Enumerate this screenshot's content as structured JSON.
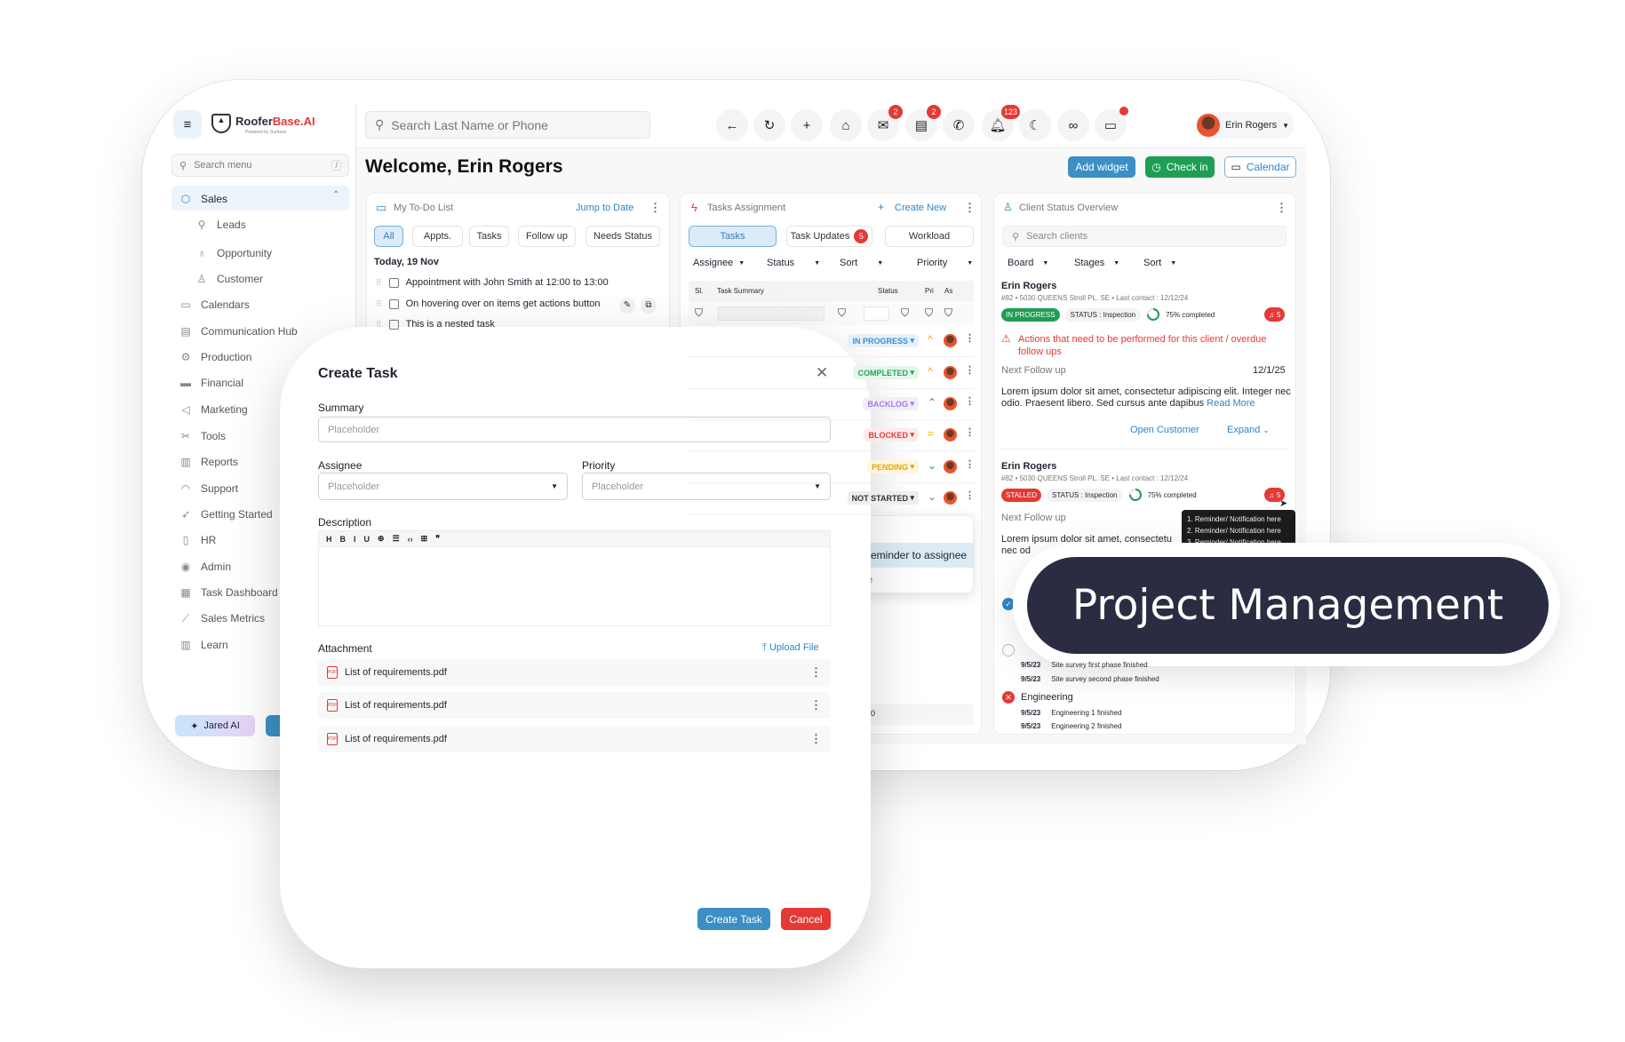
{
  "brand": {
    "name_a": "Roofer",
    "name_b": "Base.AI",
    "sub": "Powered by Surbase",
    "accent": "#e53935"
  },
  "sidebar": {
    "search_placeholder": "Search menu",
    "shortcut": "/",
    "items": [
      {
        "label": "Sales",
        "icon": "sales-icon",
        "glyph": "⬡",
        "active": true,
        "sub": false
      },
      {
        "label": "Leads",
        "icon": "leads-icon",
        "glyph": "⚲",
        "sub": true
      },
      {
        "label": "Opportunity",
        "icon": "lightbulb-icon",
        "glyph": "♁",
        "sub": true
      },
      {
        "label": "Customer",
        "icon": "customer-icon",
        "glyph": "♙",
        "sub": true
      },
      {
        "label": "Calendars",
        "icon": "calendar-icon",
        "glyph": "▭",
        "sub": false
      },
      {
        "label": "Communication Hub",
        "icon": "chat-icon",
        "glyph": "▤",
        "sub": false
      },
      {
        "label": "Production",
        "icon": "production-icon",
        "glyph": "⚙",
        "sub": false
      },
      {
        "label": "Financial",
        "icon": "wallet-icon",
        "glyph": "▬",
        "sub": false
      },
      {
        "label": "Marketing",
        "icon": "megaphone-icon",
        "glyph": "◁",
        "sub": false
      },
      {
        "label": "Tools",
        "icon": "tools-icon",
        "glyph": "✂",
        "sub": false
      },
      {
        "label": "Reports",
        "icon": "reports-icon",
        "glyph": "▥",
        "sub": false
      },
      {
        "label": "Support",
        "icon": "headset-icon",
        "glyph": "◠",
        "sub": false
      },
      {
        "label": "Getting Started",
        "icon": "rocket-icon",
        "glyph": "➶",
        "sub": false
      },
      {
        "label": "HR",
        "icon": "badge-icon",
        "glyph": "▯",
        "sub": false
      },
      {
        "label": "Admin",
        "icon": "shield-icon",
        "glyph": "◉",
        "sub": false
      },
      {
        "label": "Task Dashboard",
        "icon": "dashboard-icon",
        "glyph": "▦",
        "sub": false
      },
      {
        "label": "Sales Metrics",
        "icon": "chart-icon",
        "glyph": "⟋",
        "sub": false
      },
      {
        "label": "Learn",
        "icon": "books-icon",
        "glyph": "▥",
        "sub": false
      }
    ],
    "jared": "Jared AI"
  },
  "header": {
    "search_placeholder": "Search Last Name or Phone",
    "icons": [
      {
        "name": "back-icon",
        "glyph": "←"
      },
      {
        "name": "refresh-icon",
        "glyph": "↻"
      },
      {
        "name": "add-icon",
        "glyph": "+"
      },
      {
        "name": "home-icon",
        "glyph": "⌂"
      },
      {
        "name": "mail-icon",
        "glyph": "✉",
        "badge": "2"
      },
      {
        "name": "message-icon",
        "glyph": "▤",
        "badge": "2"
      },
      {
        "name": "phone-icon",
        "glyph": "✆"
      },
      {
        "name": "bell-icon",
        "glyph": "🔔︎",
        "badge": "123"
      },
      {
        "name": "moon-icon",
        "glyph": "☾"
      },
      {
        "name": "glasses-icon",
        "glyph": "∞"
      },
      {
        "name": "window-icon",
        "glyph": "▭",
        "dot": true
      }
    ],
    "user": "Erin Rogers"
  },
  "welcome": "Welcome, Erin Rogers",
  "actions": {
    "add_widget": "Add widget",
    "check_in": "Check in",
    "calendar": "Calendar"
  },
  "todo": {
    "title": "My To-Do List",
    "jump": "Jump to Date",
    "filters": [
      "All",
      "Appts.",
      "Tasks",
      "Follow up",
      "Needs Status"
    ],
    "date": "Today, 19 Nov",
    "items": [
      "Appointment with John Smith at 12:00 to 13:00",
      "On hovering over on items get actions button",
      "This is a nested task"
    ]
  },
  "tasks": {
    "title": "Tasks Assignment",
    "create": "Create New",
    "tabs": [
      "Tasks",
      "Task Updates",
      "Workload"
    ],
    "updates_badge": "5",
    "filters": [
      "Assignee",
      "Status",
      "Sort",
      "Priority"
    ],
    "columns": [
      "Sl.",
      "Task Summary",
      "Status",
      "Pri",
      "As"
    ],
    "rows": [
      {
        "status": "IN PROGRESS",
        "fg": "#3b8fd0",
        "bg": "#e6f1fa",
        "pri": "^",
        "pc": "#f39c12"
      },
      {
        "status": "COMPLETED",
        "fg": "#22a55a",
        "bg": "#e6f6ec",
        "pri": "^",
        "pc": "#f39c12"
      },
      {
        "status": "BACKLOG",
        "fg": "#a67bd8",
        "bg": "#f3ecfb",
        "pri": "⌃",
        "pc": "#e53935"
      },
      {
        "status": "BLOCKED",
        "fg": "#e53935",
        "bg": "#fdecec",
        "pri": "=",
        "pc": "#f1b400"
      },
      {
        "status": "PENDING",
        "fg": "#e0a800",
        "bg": "#fdf6e0",
        "pri": "⌄",
        "pc": "#22a55a"
      },
      {
        "status": "NOT STARTED",
        "fg": "#333",
        "bg": "#eeeeee",
        "pri": "⌄",
        "pc": "#3b8fd0"
      }
    ],
    "menu_highlight": "reminder to assignee",
    "menu_danger": "e",
    "footer": "20"
  },
  "clients": {
    "title": "Client Status Overview",
    "search_placeholder": "Search clients",
    "filters": [
      "Board",
      "Stages",
      "Sort"
    ],
    "cards": [
      {
        "name": "Erin Rogers",
        "id": "#82",
        "address": "5030 QUEENS Stroll PL. SE",
        "last": "Last contact : 12/12/24",
        "state": "IN PROGRESS",
        "state_color": "#1e9e54",
        "status": "STATUS : Inspection",
        "progress": 75,
        "progress_text": "75% completed",
        "alerts": "5"
      },
      {
        "name": "Erin Rogers",
        "id": "#82",
        "address": "5030 QUEENS Stroll PL. SE",
        "last": "Last contact : 12/12/24",
        "state": "STALLED",
        "state_color": "#e53935",
        "status": "STATUS : Inspection",
        "progress": 75,
        "progress_text": "75% completed",
        "alerts": "5"
      }
    ],
    "warning": "Actions that need to be performed for this client / overdue follow ups",
    "next_label": "Next Follow up",
    "next_date": "12/1/25",
    "lorem": "Lorem ipsum dolor sit amet, consectetur adipiscing elit. Integer nec odio. Praesent libero. Sed cursus ante dapibus",
    "lorem_short_a": "Lorem ipsum dolor sit amet, consectetu",
    "lorem_short_b": "nec od",
    "read_more": "Read More",
    "open_customer": "Open Customer",
    "expand": "Expand",
    "tooltip": [
      "1. Reminder/ Notification here",
      "2. Reminder/ Notification here",
      "3. Reminder/ Notification here"
    ],
    "timeline": [
      {
        "date": "9/5/23",
        "text": "Site survey first phase finished"
      },
      {
        "date": "9/5/23",
        "text": "Site survey second phase finished"
      }
    ],
    "engineering": "Engineering",
    "engineering_items": [
      {
        "date": "9/5/23",
        "text": "Engineering 1 finished"
      },
      {
        "date": "9/5/23",
        "text": "Engineering 2 finished"
      }
    ]
  },
  "modal": {
    "title": "Create Task",
    "summary_label": "Summary",
    "summary_placeholder": "Placeholder",
    "assignee_label": "Assignee",
    "assignee_placeholder": "Placeholder",
    "priority_label": "Priority",
    "priority_placeholder": "Placeholder",
    "description_label": "Description",
    "toolbar": [
      "H",
      "B",
      "I",
      "U",
      "⊕",
      "☰",
      "‹›",
      "⊞",
      "❞"
    ],
    "attachment_label": "Attachment",
    "upload": "Upload File",
    "files": [
      "List of requirements.pdf",
      "List of requirements.pdf",
      "List of requirements.pdf"
    ],
    "create": "Create Task",
    "cancel": "Cancel"
  },
  "banner": "Project Management",
  "colors": {
    "primary": "#3b8fc4",
    "success": "#1e9e54",
    "danger": "#e53935",
    "banner": "#2a2d42"
  }
}
